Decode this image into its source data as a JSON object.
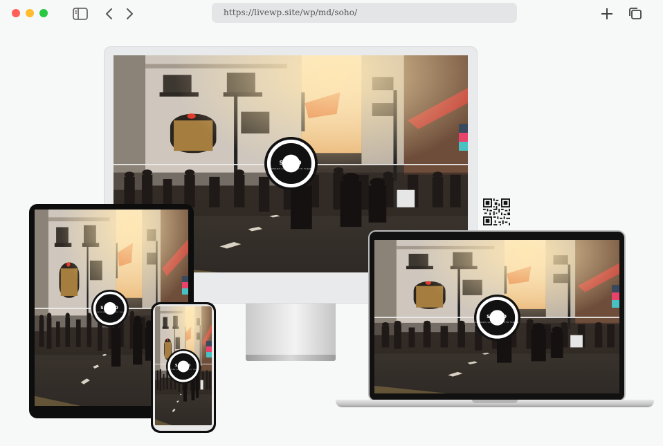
{
  "browser": {
    "url": "https://livewp.site/wp/md/soho/",
    "icons": [
      "sidebar-toggle-icon",
      "back-chevron-icon",
      "forward-chevron-icon",
      "new-tab-plus-icon",
      "tabs-overview-icon"
    ]
  },
  "site": {
    "brand": "SOHO",
    "tagline": "MODERN FASHION PHOTO THEME",
    "side_icons": [
      "monitor-icon",
      "cart-icon",
      "download-icon"
    ]
  },
  "devices": [
    "desktop-monitor",
    "tablet",
    "smartphone",
    "laptop"
  ],
  "colors": {
    "side_button_dark": "#3a4a5e",
    "side_button_red": "#e8446b",
    "side_button_teal": "#49c0c2",
    "badge": "#111111"
  }
}
